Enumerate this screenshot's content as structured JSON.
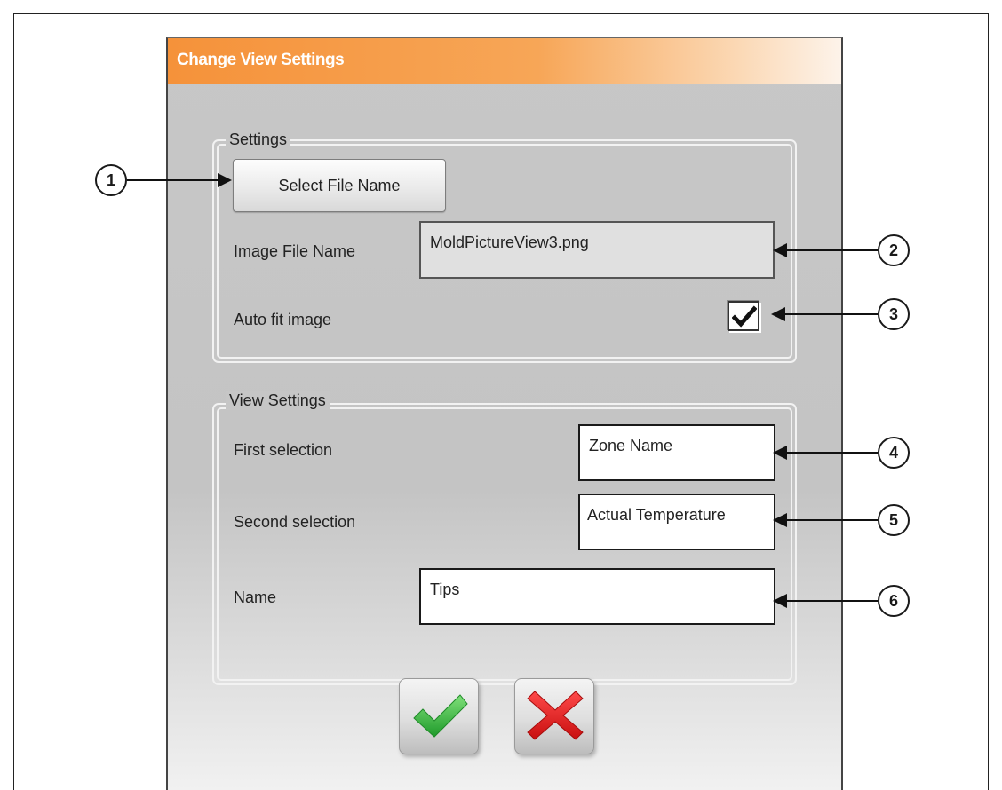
{
  "dialog": {
    "title": "Change View Settings"
  },
  "settings_group": {
    "legend": "Settings",
    "select_file_button": "Select File Name",
    "image_file_label": "Image File Name",
    "image_file_value": "MoldPictureView3.png",
    "auto_fit_label": "Auto fit image",
    "auto_fit_checked": true
  },
  "view_settings_group": {
    "legend": "View Settings",
    "first_selection_label": "First selection",
    "first_selection_value": "Zone Name",
    "second_selection_label": "Second selection",
    "second_selection_value": "Actual Temperature",
    "name_label": "Name",
    "name_value": "Tips"
  },
  "actions": {
    "ok_icon": "green-checkmark-icon",
    "cancel_icon": "red-x-icon"
  },
  "callouts": [
    "1",
    "2",
    "3",
    "4",
    "5",
    "6"
  ],
  "colors": {
    "title_bar_start": "#f5923a",
    "title_bar_end": "#fdf3ea",
    "ok_green": "#39c043",
    "cancel_red": "#e21a1a"
  }
}
